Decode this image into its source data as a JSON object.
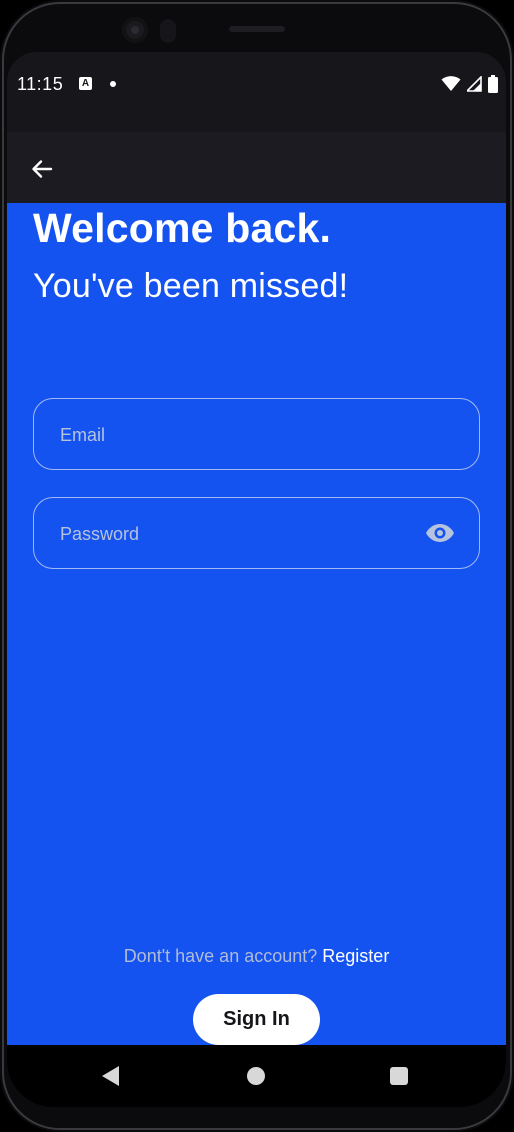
{
  "status_bar": {
    "time": "11:15",
    "notification_icons": [
      "a-letter-icon",
      "dot-icon"
    ],
    "system_icons": [
      "wifi-icon",
      "signal-icon",
      "battery-icon"
    ]
  },
  "app_bar": {
    "back_icon": "arrow-left-icon"
  },
  "login": {
    "title": "Welcome back.",
    "subtitle": "You've been missed!",
    "email_placeholder": "Email",
    "email_value": "",
    "password_placeholder": "Password",
    "password_value": "",
    "password_toggle_icon": "eye-icon",
    "register_prompt": "Dont't have an account?",
    "register_link": "Register",
    "sign_in_label": "Sign In"
  },
  "nav_bar": {
    "buttons": [
      "back-triangle-icon",
      "home-circle-icon",
      "recents-square-icon"
    ]
  },
  "colors": {
    "primary_blue": "#1553f0",
    "app_bar_dark": "#1c1b22",
    "status_bar_dark": "#17161b",
    "button_white": "#ffffff",
    "muted_text": "#b0bbd7"
  }
}
